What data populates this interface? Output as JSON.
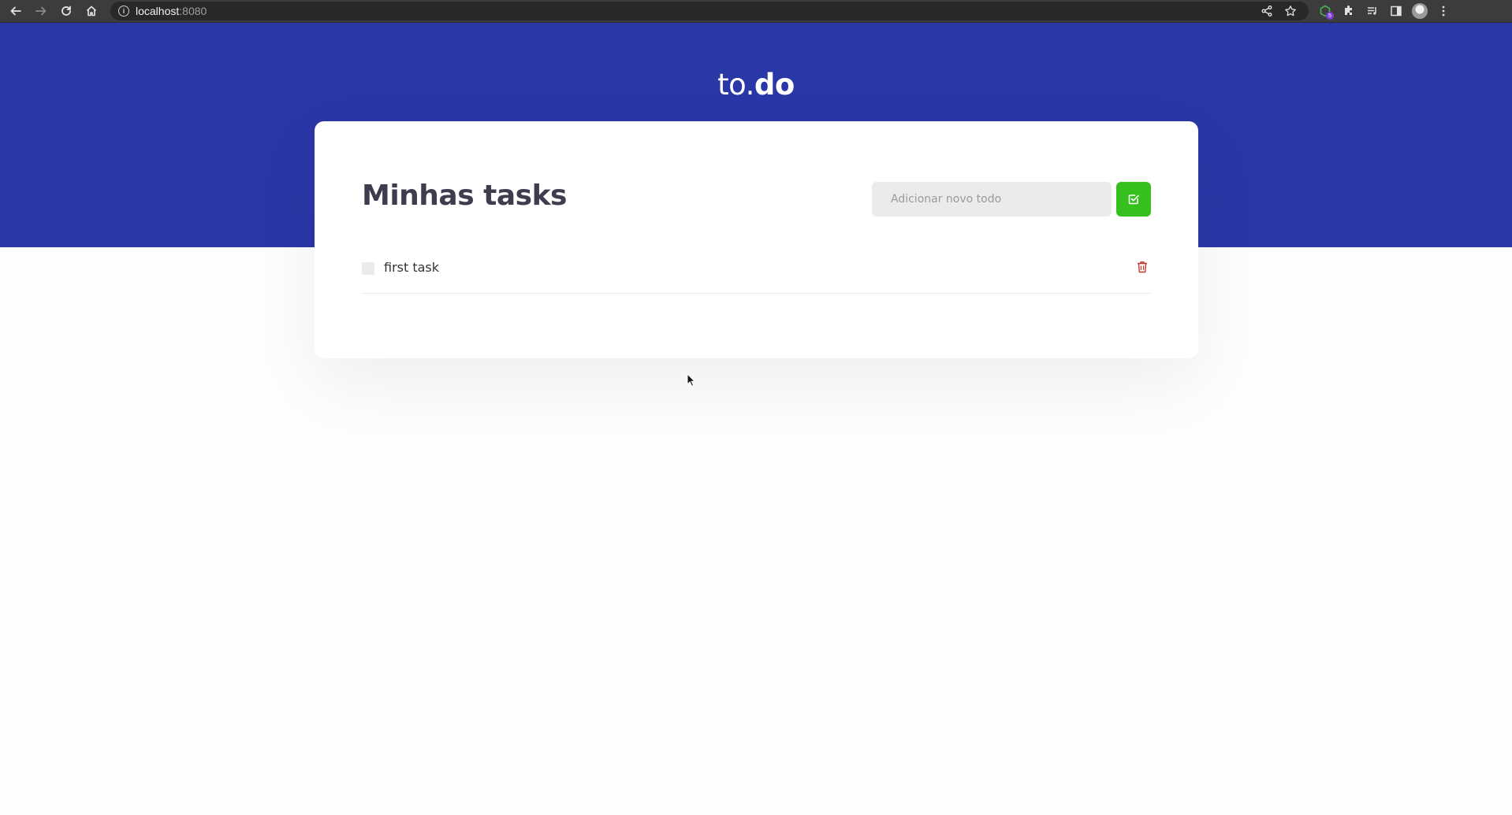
{
  "browser": {
    "url_host": "localhost",
    "url_port": ":8080",
    "extension_badge": "5"
  },
  "app": {
    "brand_light": "to.",
    "brand_bold": "do",
    "title": "Minhas tasks",
    "new_todo_placeholder": "Adicionar novo todo",
    "tasks": [
      {
        "label": "first task",
        "completed": false
      }
    ]
  },
  "colors": {
    "hero": "#2a37a6",
    "add_button": "#36c01e",
    "delete_icon": "#c0392b"
  },
  "icons": {
    "back": "arrow-left-icon",
    "forward": "arrow-right-icon",
    "reload": "reload-icon",
    "home": "home-icon",
    "add": "checkbox-check-icon",
    "delete": "trash-icon"
  }
}
